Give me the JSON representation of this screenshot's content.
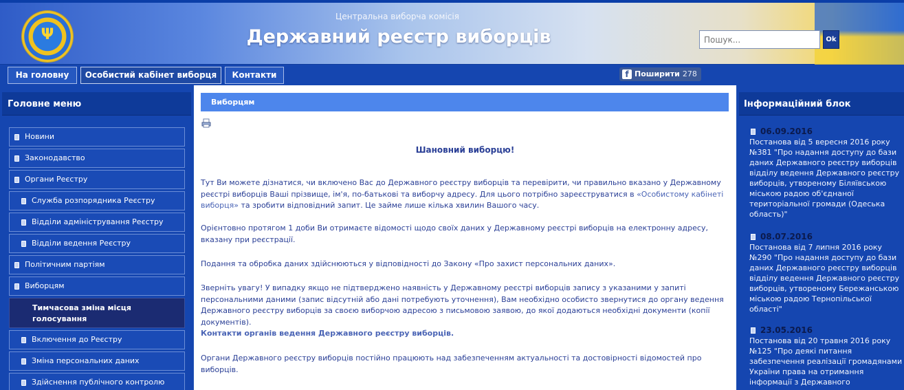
{
  "header": {
    "subtitle": "Центральна виборча комісія",
    "title": "Державний реєстр виборців",
    "search_placeholder": "Пошук...",
    "search_button": "Ok"
  },
  "nav": {
    "items": [
      {
        "label": "На головну"
      },
      {
        "label": "Особистий кабінет виборця"
      },
      {
        "label": "Контакти"
      }
    ],
    "share_label": "Поширити",
    "share_count": "278"
  },
  "left": {
    "heading": "Головне меню",
    "menu": [
      {
        "label": "Новини"
      },
      {
        "label": "Законодавство"
      },
      {
        "label": "Органи Реєстру"
      },
      {
        "label": "Служба розпорядника Реєстру"
      },
      {
        "label": "Відділи адміністрування Реєстру"
      },
      {
        "label": "Відділи ведення Реєстру"
      },
      {
        "label": "Політичним партіям"
      },
      {
        "label": "Виборцям"
      },
      {
        "label": "Тимчасова зміна місця голосування"
      },
      {
        "label": "Включення до Реєстру"
      },
      {
        "label": "Зміна персональних даних"
      },
      {
        "label": "Здійснення публічного контролю"
      }
    ]
  },
  "center": {
    "section_title": "Виборцям",
    "greeting": "Шановний виборцю!",
    "p1_before": "Тут Ви можете дізнатися, чи включено Вас до Державного реєстру виборців та перевірити, чи правильно вказано у Державному реєстрі виборців Ваші прізвище, ім'я, по-батькові та виборчу адресу. Для цього потрібно зареєструватися в ",
    "p1_link": "«Особистому кабінеті виборця»",
    "p1_after": " та зробити відповідний запит. Це займе лише кілька хвилин Вашого часу.",
    "p2": "Орієнтовно протягом 1 доби Ви отримаєте відомості щодо своїх даних у Державному реєстрі виборців на електронну адресу, вказану при реєстрації.",
    "p3": "Подання та обробка даних здійснюються у відповідності до Закону «Про захист персональних даних».",
    "p4": "Зверніть увагу! У випадку якщо не підтверджено наявність у Державному реєстрі виборців запису з указаними у запиті персональними даними (запис відсутній або дані потребують уточнення), Вам необхідно особисто звернутися до органу ведення Державного реєстру виборців за своєю виборчою адресою з письмовою заявою, до якої додаються необхідні документи (копії документів).",
    "contacts_link": "Контакти органів ведення Державного реєстру виборців.",
    "p5": "Органи Державного реєстру виборців постійно працюють над забезпеченням актуальності та достовірності відомостей про виборців."
  },
  "right": {
    "heading": "Інформаційний блок",
    "news": [
      {
        "date": "06.09.2016",
        "text": "Постанова від 5 вересня 2016 року №381 \"Про надання доступу до бази даних Державного реєстру виборців відділу ведення Державного реєстру виборців, утвореному Біляївською міською радою об'єднаної територіальної громади (Одеська область)\""
      },
      {
        "date": "08.07.2016",
        "text": "Постанова від 7 липня 2016 року №290 \"Про надання доступу до бази даних Державного реєстру виборців відділу ведення Державного реєстру виборців, утвореному Бережанською міською радою Тернопільської області\""
      },
      {
        "date": "23.05.2016",
        "text": "Постанова від 20 травня 2016 року №125 \"Про деякі питання забезпечення реалізації громадянами України права на отримання інформації з Державного"
      }
    ]
  }
}
